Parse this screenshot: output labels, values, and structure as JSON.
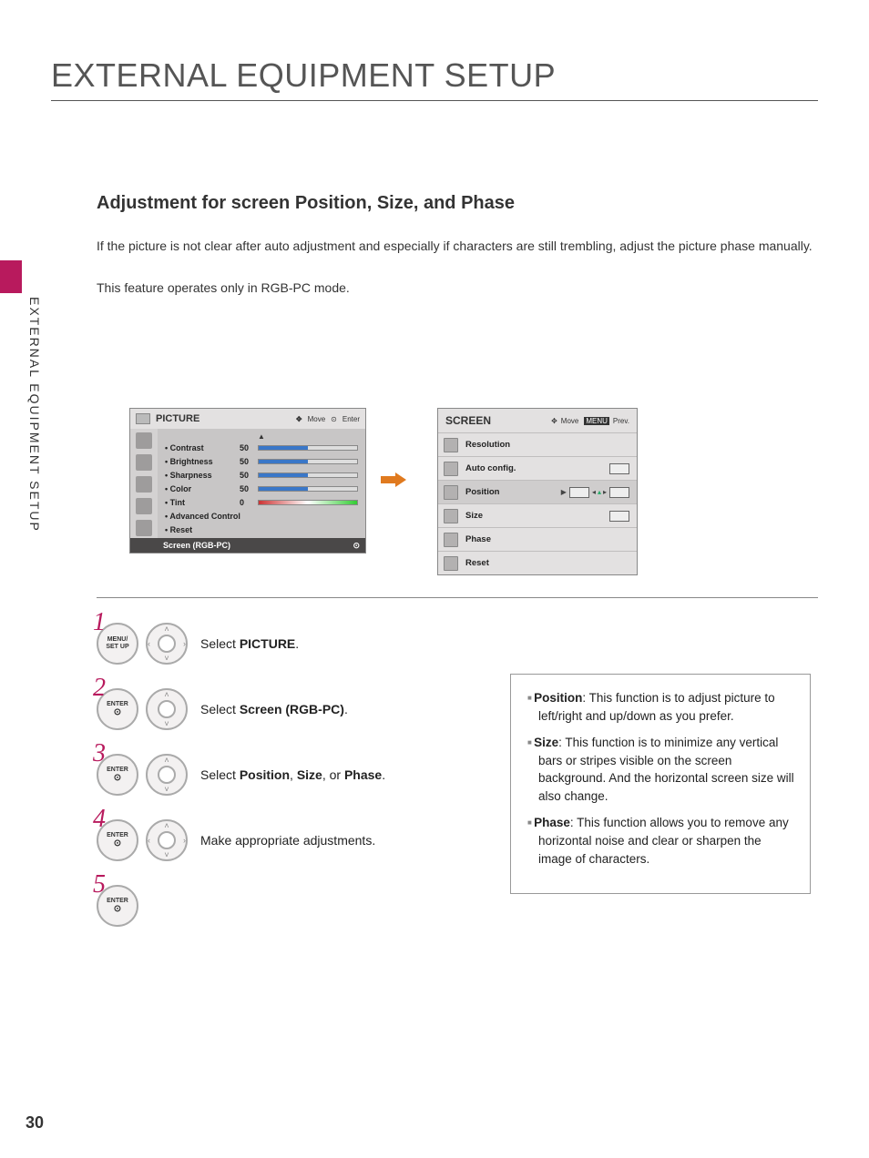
{
  "page": {
    "title": "EXTERNAL EQUIPMENT SETUP",
    "sidebar_label": "EXTERNAL EQUIPMENT SETUP",
    "page_number": "30"
  },
  "section": {
    "heading": "Adjustment for screen Position, Size, and Phase",
    "body1": "If the picture is not clear after auto adjustment and especially if characters are still trembling, adjust the picture phase manually.",
    "body2": "This feature operates only in RGB-PC mode."
  },
  "osd_picture": {
    "title": "PICTURE",
    "hint_move": "Move",
    "hint_enter": "Enter",
    "items": {
      "contrast": {
        "label": "• Contrast",
        "value": "50"
      },
      "brightness": {
        "label": "• Brightness",
        "value": "50"
      },
      "sharpness": {
        "label": "• Sharpness",
        "value": "50"
      },
      "color": {
        "label": "• Color",
        "value": "50"
      },
      "tint": {
        "label": "• Tint",
        "value": "0"
      },
      "advanced": {
        "label": "• Advanced Control"
      },
      "reset": {
        "label": "• Reset"
      }
    },
    "selected": "Screen (RGB-PC)"
  },
  "osd_screen": {
    "title": "SCREEN",
    "hint_move": "Move",
    "hint_prev_badge": "MENU",
    "hint_prev": "Prev.",
    "items": {
      "resolution": "Resolution",
      "autocfg": "Auto config.",
      "position": "Position",
      "size": "Size",
      "phase": "Phase",
      "reset": "Reset"
    }
  },
  "steps": {
    "1": {
      "num": "1",
      "button": "MENU/\nSET UP",
      "text_pre": "Select ",
      "bold": "PICTURE",
      "text_post": "."
    },
    "2": {
      "num": "2",
      "button": "ENTER",
      "text_pre": "Select ",
      "bold": "Screen (RGB-PC)",
      "text_post": "."
    },
    "3": {
      "num": "3",
      "button": "ENTER",
      "text_pre": "Select ",
      "bold1": "Position",
      "mid1": ", ",
      "bold2": "Size",
      "mid2": ", or ",
      "bold3": "Phase",
      "text_post": "."
    },
    "4": {
      "num": "4",
      "button": "ENTER",
      "text": "Make appropriate adjustments."
    },
    "5": {
      "num": "5",
      "button": "ENTER"
    }
  },
  "info": {
    "position": {
      "b": "Position",
      "t": ": This function is to adjust picture to left/right and up/down as you prefer."
    },
    "size": {
      "b": "Size",
      "t": ": This function is to minimize any vertical bars or stripes visible on the screen background. And the horizontal screen size will also change."
    },
    "phase": {
      "b": "Phase",
      "t": ": This function allows you to remove any horizontal noise and clear or sharpen the image of characters."
    }
  }
}
